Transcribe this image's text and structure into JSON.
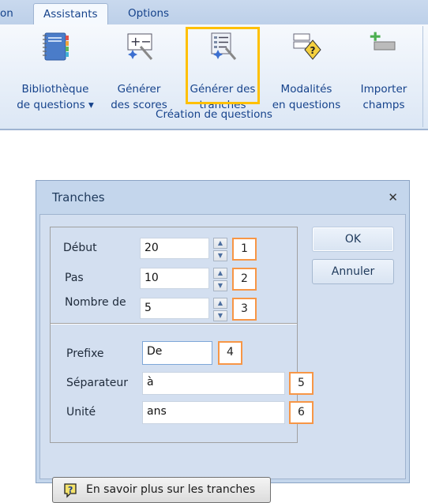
{
  "ribbon": {
    "tabs": [
      {
        "label": "on",
        "active": false
      },
      {
        "label": "Assistants",
        "active": true
      },
      {
        "label": "Options",
        "active": false
      }
    ],
    "buttons": [
      {
        "icon": "question-library-icon",
        "line1": "Bibliothèque",
        "line2": "de questions ▾"
      },
      {
        "icon": "generate-scores-icon",
        "line1": "Générer",
        "line2": "des scores"
      },
      {
        "icon": "generate-ranges-icon",
        "line1": "Générer des",
        "line2": "tranches"
      },
      {
        "icon": "modalities-icon",
        "line1": "Modalités",
        "line2": "en questions"
      },
      {
        "icon": "import-fields-icon",
        "line1": "Importer",
        "line2": "champs"
      }
    ],
    "group_label": "Création de questions",
    "highlight_color": "#ffc000"
  },
  "dialog": {
    "title": "Tranches",
    "close_glyph": "✕",
    "fields_top": [
      {
        "label": "Début",
        "value": "20",
        "badge": "1"
      },
      {
        "label": "Pas",
        "value": "10",
        "badge": "2"
      },
      {
        "label": "Nombre de",
        "value": "5",
        "badge": "3"
      }
    ],
    "fields_bottom": [
      {
        "label": "Prefixe",
        "value": "De",
        "badge": "4"
      },
      {
        "label": "Séparateur",
        "value": "à",
        "badge": "5"
      },
      {
        "label": "Unité",
        "value": "ans",
        "badge": "6"
      }
    ],
    "ok_label": "OK",
    "cancel_label": "Annuler",
    "help_label": "En savoir plus sur les tranches",
    "badge_color": "#f79646"
  }
}
